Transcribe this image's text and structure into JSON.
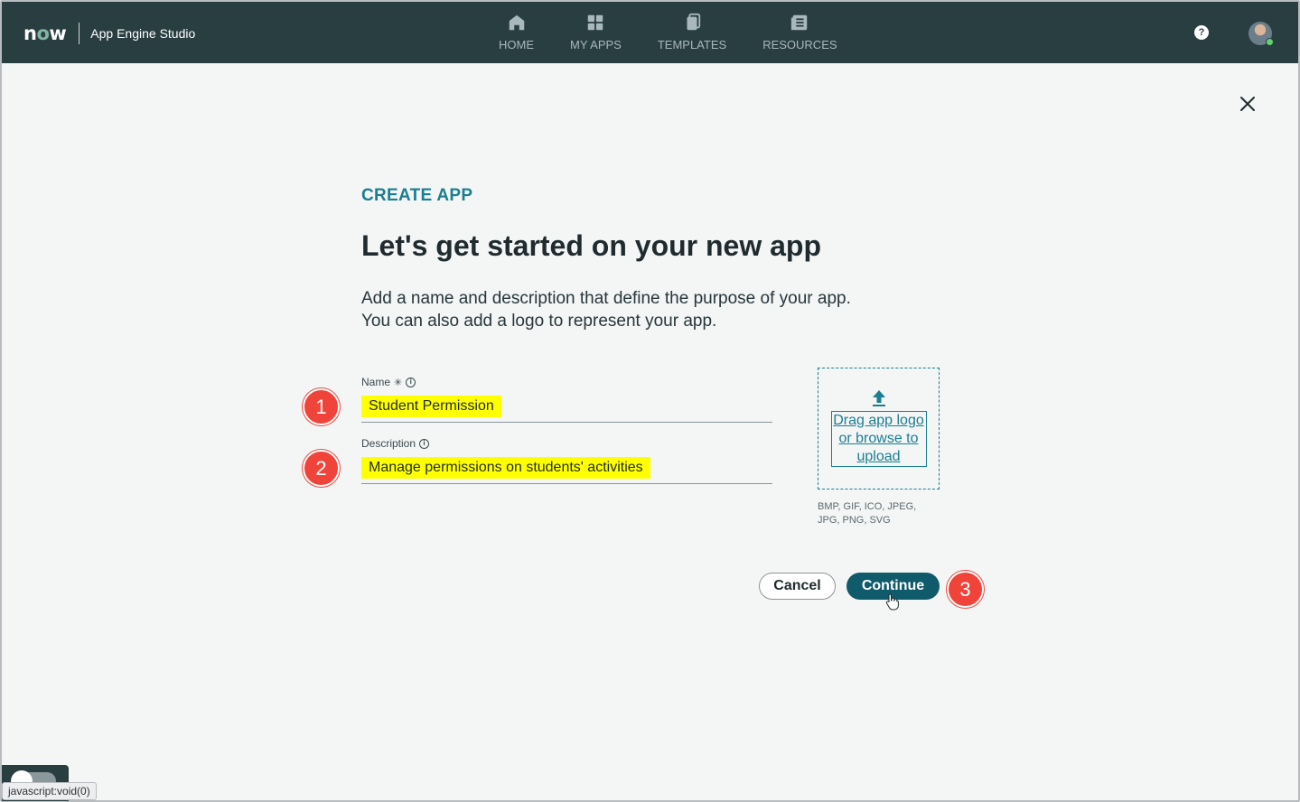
{
  "header": {
    "brand": "now",
    "app_name": "App Engine Studio",
    "nav": [
      {
        "label": "HOME",
        "icon": "home-icon"
      },
      {
        "label": "MY APPS",
        "icon": "grid-icon"
      },
      {
        "label": "TEMPLATES",
        "icon": "templates-icon"
      },
      {
        "label": "RESOURCES",
        "icon": "resources-icon"
      }
    ],
    "help_glyph": "?"
  },
  "main": {
    "eyebrow": "CREATE APP",
    "title": "Let's get started on your new app",
    "subtitle_line1": "Add a name and description that define the purpose of your app.",
    "subtitle_line2": "You can also add a logo to represent your app.",
    "name_label": "Name",
    "name_required_glyph": "✳",
    "name_value": "Student Permission",
    "description_label": "Description",
    "description_value": "Manage permissions on students' activities",
    "upload_text": "Drag app logo or browse to upload",
    "formats": "BMP, GIF, ICO, JPEG, JPG, PNG, SVG",
    "cancel_label": "Cancel",
    "continue_label": "Continue"
  },
  "annotations": {
    "step1": "1",
    "step2": "2",
    "step3": "3"
  },
  "status_bar": "javascript:void(0)",
  "colors": {
    "header_bg": "#293e41",
    "accent": "#1a7f92",
    "primary_button": "#0f5a6b",
    "highlight": "#ffff00",
    "step_badge": "#f0443a"
  }
}
